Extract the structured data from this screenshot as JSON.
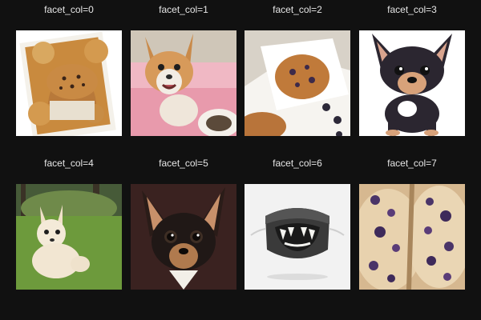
{
  "facets": [
    {
      "title": "facet_col=0",
      "image": "blueberry-muffins-photo"
    },
    {
      "title": "facet_col=1",
      "image": "chihuahua-on-pink-bed-photo"
    },
    {
      "title": "facet_col=2",
      "image": "blueberry-muffin-on-paper-photo"
    },
    {
      "title": "facet_col=3",
      "image": "cartoon-chihuahua-illustration"
    },
    {
      "title": "facet_col=4",
      "image": "chihuahua-on-grass-photo"
    },
    {
      "title": "facet_col=5",
      "image": "black-tan-chihuahua-portrait-photo"
    },
    {
      "title": "facet_col=6",
      "image": "dog-teeth-face-mask-photo"
    },
    {
      "title": "facet_col=7",
      "image": "blueberry-muffin-closeup-photo"
    }
  ]
}
